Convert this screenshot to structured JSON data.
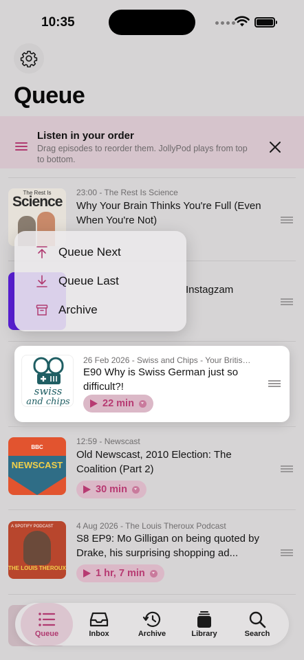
{
  "status": {
    "time": "10:35"
  },
  "page": {
    "title": "Queue"
  },
  "banner": {
    "title": "Listen in your order",
    "subtitle": "Drag episodes to reorder them. JollyPod plays from top to bottom."
  },
  "menu": {
    "items": [
      {
        "label": "Queue Next",
        "icon": "arrow-up-to-line-icon"
      },
      {
        "label": "Queue Last",
        "icon": "arrow-down-to-line-icon"
      },
      {
        "label": "Archive",
        "icon": "archive-box-icon"
      }
    ]
  },
  "episodes": [
    {
      "meta": "23:00 - The Rest Is Science",
      "title": "Why Your Brain Thinks You're Full (Even When You're Not)",
      "artwork_text": "Science",
      "artwork_small": "The Rest Is"
    },
    {
      "meta": "",
      "title": "Instagzam"
    },
    {
      "meta": "26 Feb 2026 - Swiss and Chips - Your British gui...",
      "title": "E90 Why is Swiss German just so difficult?!",
      "duration": "22 min",
      "artwork_text": "swiss and chips"
    },
    {
      "meta": "12:59 - Newscast",
      "title": "Old Newscast, 2010 Election: The Coalition (Part 2)",
      "duration": "30 min",
      "artwork_text": "NEWSCAST",
      "artwork_small": "BBC"
    },
    {
      "meta": "4 Aug 2026 - The Louis Theroux Podcast",
      "title": "S8 EP9: Mo Gilligan on being quoted by Drake, his surprising shopping ad...",
      "duration": "1 hr, 7 min",
      "artwork_text": "THE LOUIS THEROUX",
      "artwork_small": "A SPOTIFY PODCAST"
    }
  ],
  "tabs": [
    {
      "label": "Queue",
      "icon": "list-icon",
      "active": true
    },
    {
      "label": "Inbox",
      "icon": "tray-icon",
      "active": false
    },
    {
      "label": "Archive",
      "icon": "clock-history-icon",
      "active": false
    },
    {
      "label": "Library",
      "icon": "stack-icon",
      "active": false
    },
    {
      "label": "Search",
      "icon": "search-icon",
      "active": false
    }
  ],
  "colors": {
    "accent": "#b03a70",
    "pill_bg": "#dbb8c7",
    "banner_bg": "#d6c4cc"
  }
}
